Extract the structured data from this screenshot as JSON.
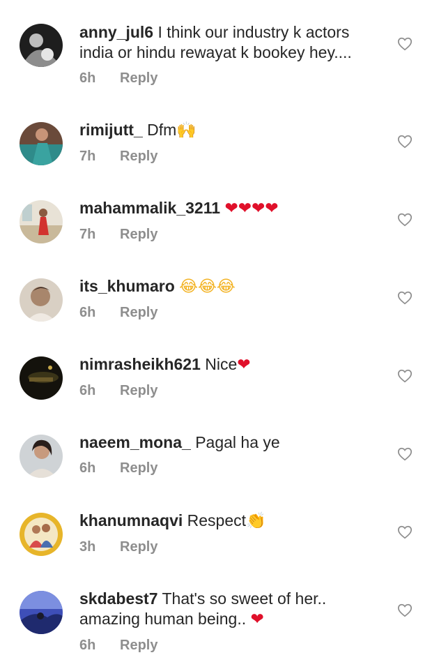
{
  "comments": [
    {
      "username": "anny_jul6",
      "text": "I think our industry k actors india or hindu rewayat k bookey hey....",
      "emoji": "",
      "time": "6h",
      "reply": "Reply",
      "avatar": "dark-portrait"
    },
    {
      "username": "rimijutt_",
      "text": "Dfm",
      "emoji": "🙌",
      "time": "7h",
      "reply": "Reply",
      "avatar": "teal-dress"
    },
    {
      "username": "mahammalik_3211",
      "text": "",
      "emoji": "❤❤❤❤",
      "time": "7h",
      "reply": "Reply",
      "avatar": "room-figure"
    },
    {
      "username": "its_khumaro",
      "text": "",
      "emoji": "😂😂😂",
      "time": "6h",
      "reply": "Reply",
      "avatar": "child-photo"
    },
    {
      "username": "nimrasheikh621",
      "text": "Nice",
      "emoji": "❤",
      "time": "6h",
      "reply": "Reply",
      "avatar": "dark-scene"
    },
    {
      "username": "naeem_mona_",
      "text": "Pagal ha ye",
      "emoji": "",
      "time": "6h",
      "reply": "Reply",
      "avatar": "woman-selfie"
    },
    {
      "username": "khanumnaqvi",
      "text": "Respect",
      "emoji": "👏",
      "time": "3h",
      "reply": "Reply",
      "avatar": "family-yellow"
    },
    {
      "username": "skdabest7",
      "text": "That's so sweet of her.. amazing human being..",
      "emoji": "❤",
      "time": "6h",
      "reply": "Reply",
      "avatar": "blue-landscape"
    }
  ],
  "icons": {
    "like": "heart-outline-icon"
  },
  "colors": {
    "text": "#262626",
    "meta": "#8e8e8e",
    "heart_emoji": "#e0102a"
  }
}
